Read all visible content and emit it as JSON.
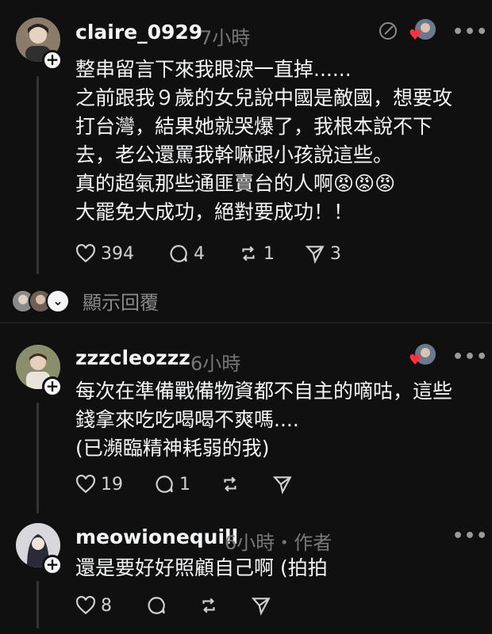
{
  "posts": [
    {
      "username": "claire_0929",
      "time": "7小時",
      "text": "整串留言下來我眼淚一直掉......\n之前跟我９歲的女兒說中國是敵國，想要攻\n打台灣，結果她就哭爆了，我根本說不下\n去，老公還罵我幹嘛跟小孩說這些。\n真的超氣那些通匪賣台的人啊😡😡😡\n大罷免大成功，絕對要成功！！",
      "likes": "394",
      "comments": "4",
      "reposts": "1",
      "shares": "3"
    },
    {
      "username": "zzzcleozzz",
      "time": "6小時",
      "text": "每次在準備戰備物資都不自主的嘀咕，這些\n錢拿來吃吃喝喝不爽嗎....\n(已瀕臨精神耗弱的我)",
      "likes": "19",
      "comments": "1",
      "reposts": "",
      "shares": ""
    },
    {
      "username": "meowionequill",
      "time": "6小時・作者",
      "text": "還是要好好照顧自己啊 (拍拍",
      "likes": "8",
      "comments": "",
      "reposts": "",
      "shares": ""
    }
  ],
  "show_replies_label": "顯示回覆",
  "more_label": "•••",
  "icons": [
    "heart-icon",
    "comment-icon",
    "repost-icon",
    "share-icon",
    "more-icon",
    "plus-icon",
    "chevron-down-icon"
  ],
  "colors": {
    "background": "#101010",
    "text": "#f3f5f7",
    "muted": "#777777",
    "heart": "#ff3040"
  }
}
